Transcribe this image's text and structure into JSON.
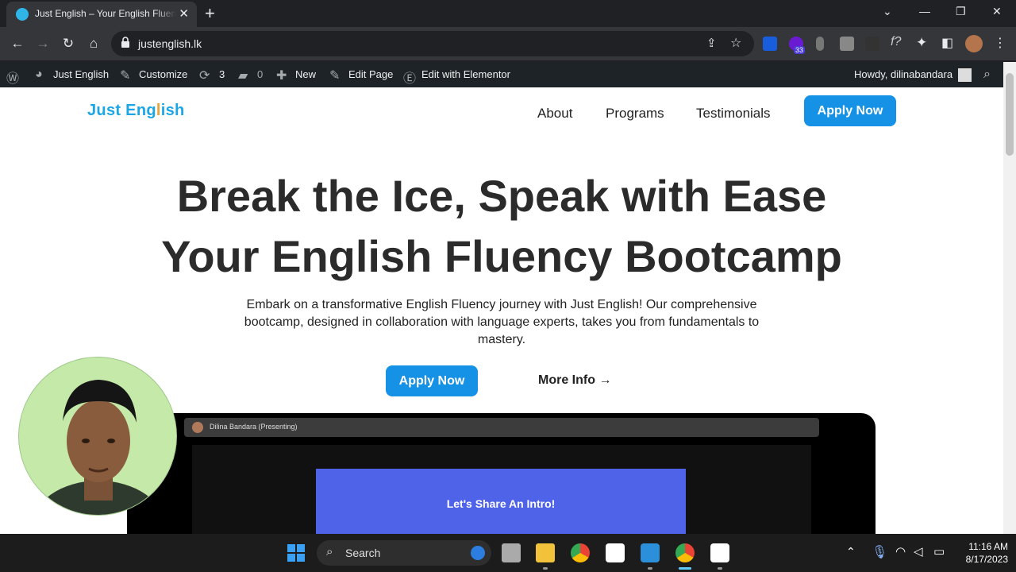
{
  "browser": {
    "tab_title": "Just English – Your English Fluency Bootcamp",
    "url": "justenglish.lk",
    "extension_badge": "33"
  },
  "wp_admin_bar": {
    "site_name": "Just English",
    "customize": "Customize",
    "updates_count": "3",
    "comments_count": "0",
    "new": "New",
    "edit_page": "Edit Page",
    "edit_elementor": "Edit with Elementor",
    "howdy": "Howdy, dilinabandara"
  },
  "site": {
    "logo_pre": "Just Eng",
    "logo_l": "l",
    "logo_post": "ish",
    "nav": [
      "About",
      "Programs",
      "Testimonials"
    ],
    "cta": "Apply Now"
  },
  "hero": {
    "line1": "Break the Ice, Speak with Ease",
    "line2": "Your English Fluency Bootcamp",
    "subtitle": "Embark on a transformative English Fluency journey with Just English! Our comprehensive bootcamp, designed in collaboration with language experts, takes you from fundamentals to mastery.",
    "apply": "Apply Now",
    "more_info": "More Info →"
  },
  "video": {
    "presenter": "Dilina Bandara (Presenting)",
    "slide_title": "Let's Share An Intro!"
  },
  "taskbar": {
    "search": "Search",
    "time": "11:16 AM",
    "date": "8/17/2023"
  },
  "colors": {
    "accent": "#1592e6",
    "logo": "#1ca7e4",
    "logo_l": "#e8a33b",
    "wp_bar": "#1d2327",
    "slide": "#4f63e8"
  }
}
